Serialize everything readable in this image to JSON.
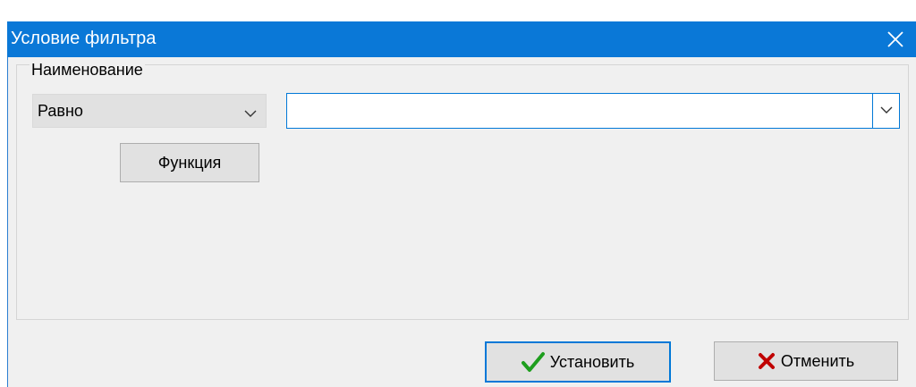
{
  "window": {
    "title": "Условие фильтра",
    "close_icon": "close-icon"
  },
  "group": {
    "label": "Наименование"
  },
  "condition": {
    "selected": "Равно",
    "arrow_icon": "chevron-down-icon"
  },
  "value": {
    "text": "",
    "arrow_icon": "chevron-down-icon"
  },
  "buttons": {
    "function_label": "Функция",
    "ok_label": "Установить",
    "ok_icon": "checkmark-icon",
    "cancel_label": "Отменить",
    "cancel_icon": "cross-icon"
  },
  "colors": {
    "titlebar": "#0a78d7",
    "focus_border": "#0078d7",
    "ok_check": "#1e9e1e",
    "cancel_cross": "#c00000"
  }
}
